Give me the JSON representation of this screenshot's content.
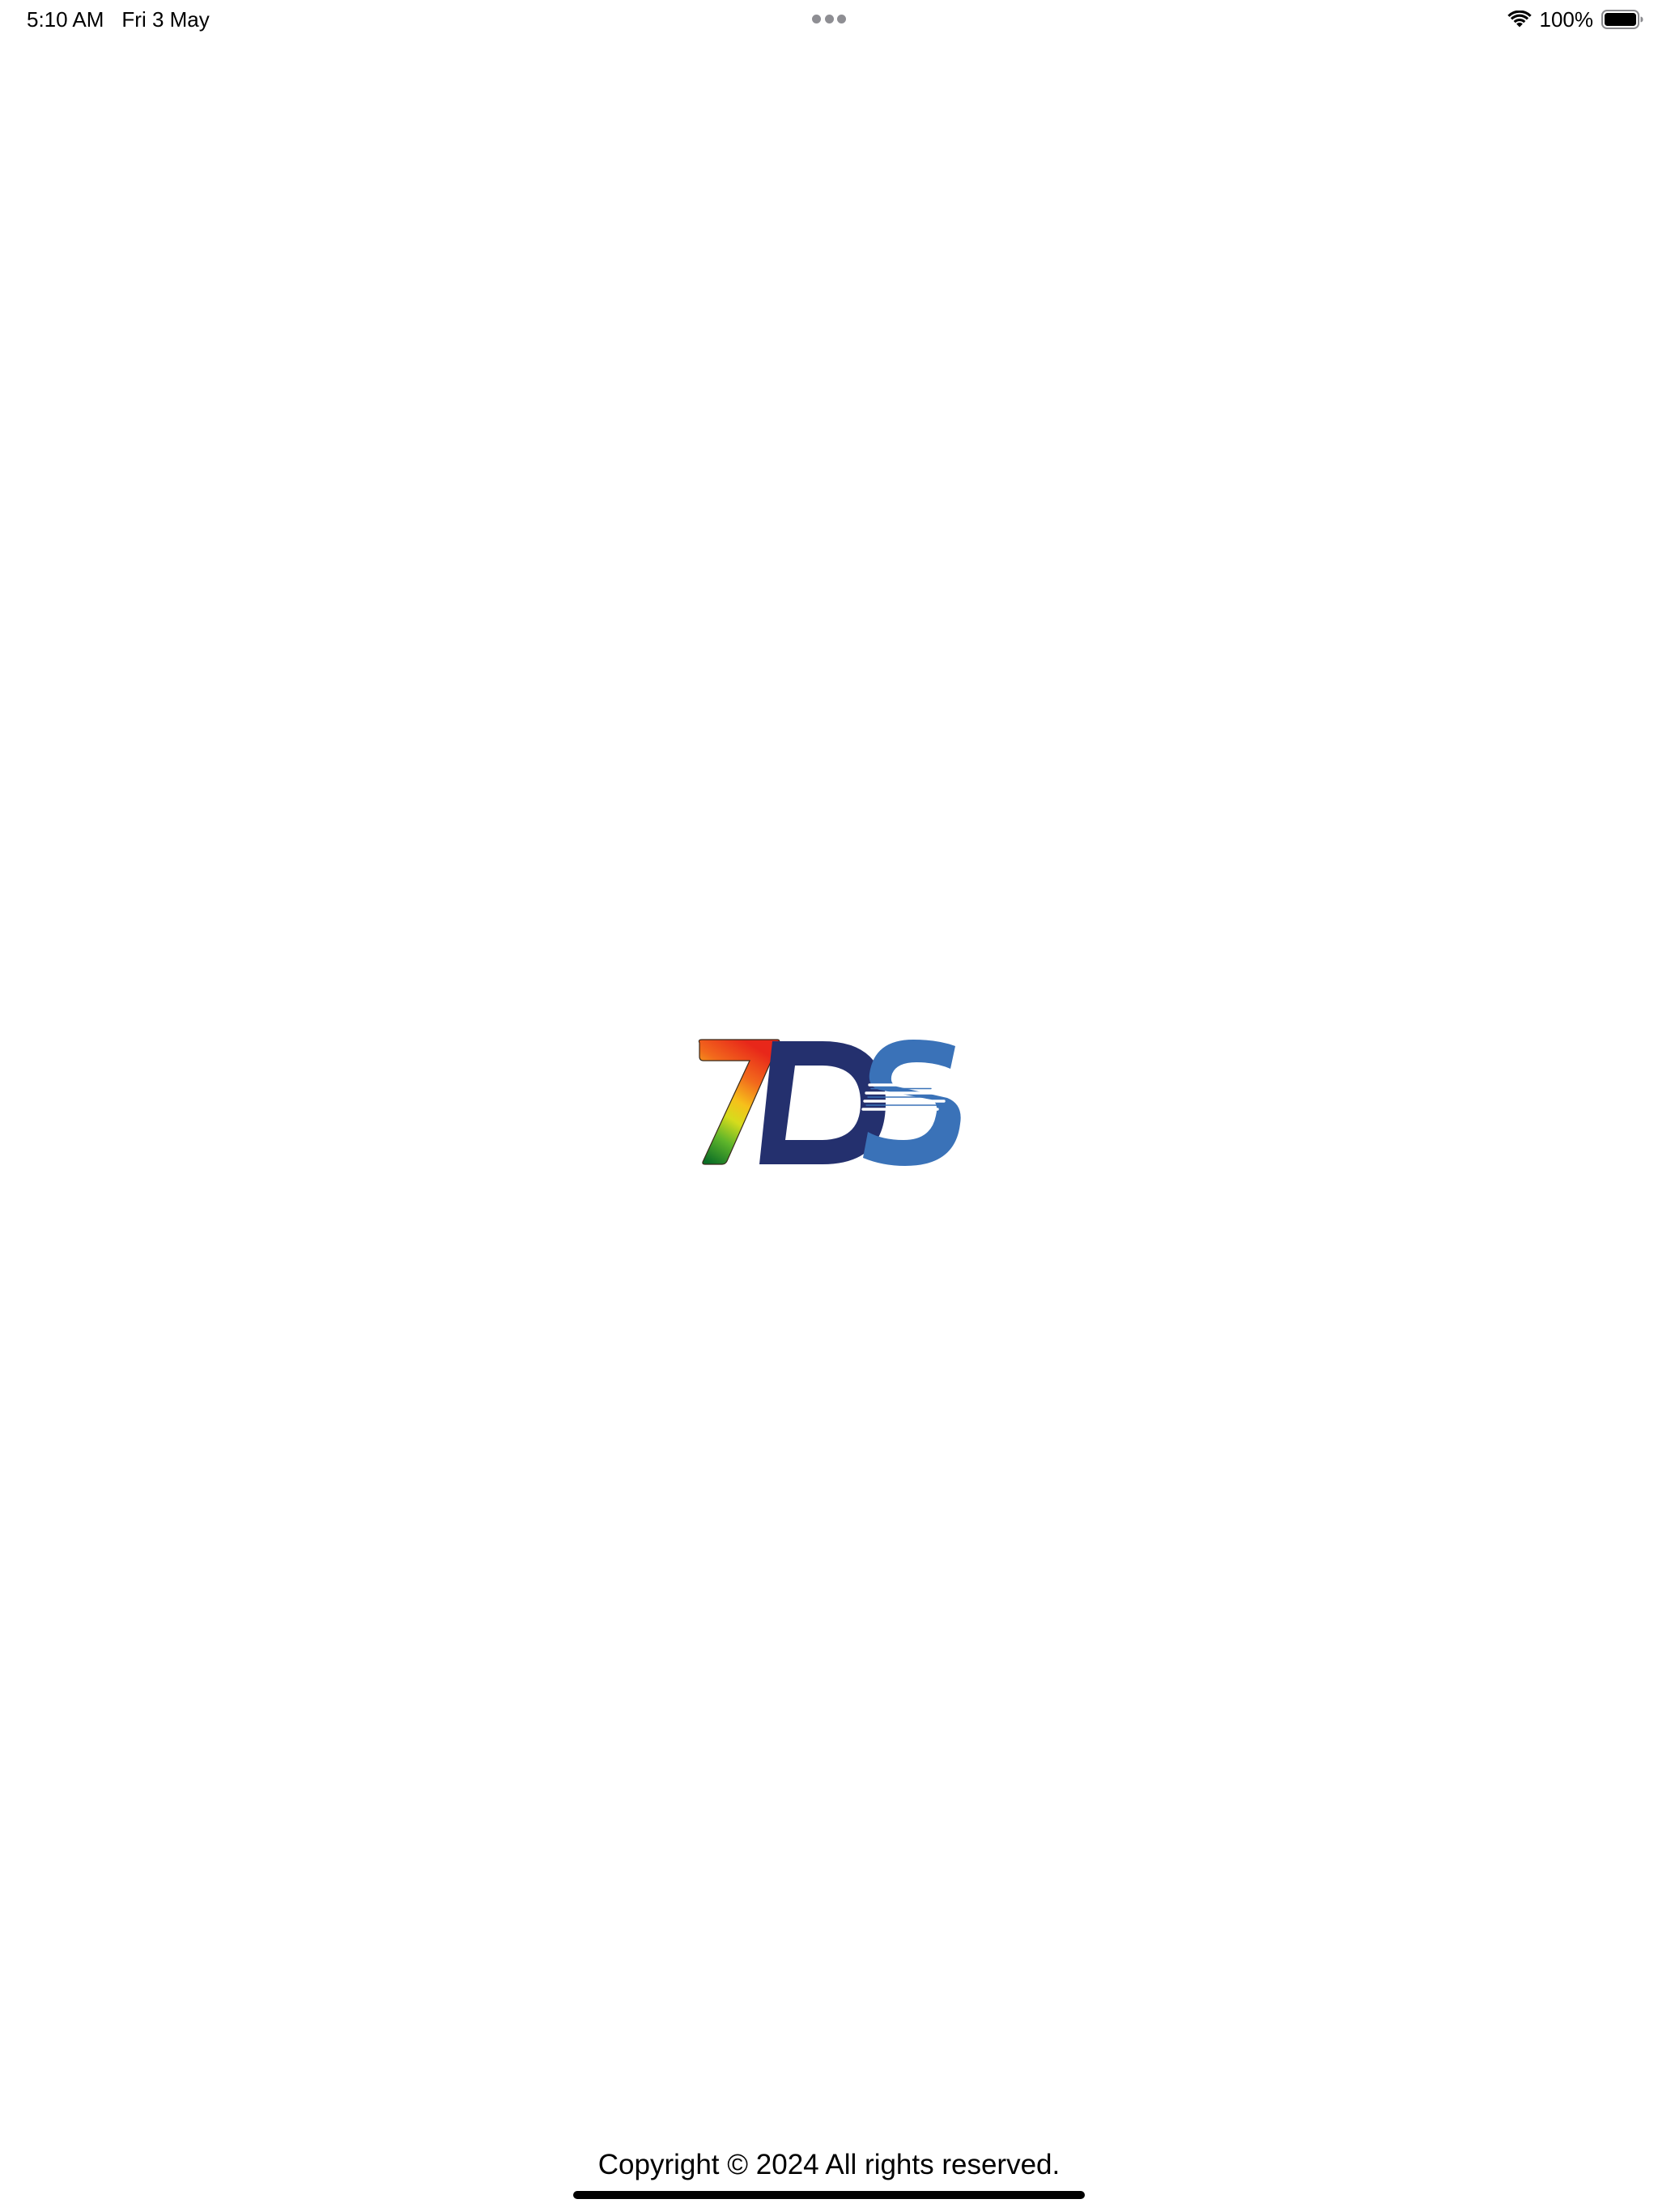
{
  "status_bar": {
    "time": "5:10 AM",
    "date": "Fri 3 May",
    "battery_percent": "100%",
    "battery_level": 1.0,
    "icons": [
      "wifi-icon",
      "battery-icon",
      "multitasking-dots-icon"
    ]
  },
  "splash": {
    "logo_text": "7DS",
    "logo_colors": {
      "seven_gradient": [
        "#e8271a",
        "#f6a21b",
        "#f3e31a",
        "#1f9a2f",
        "#0b6e26"
      ],
      "d_color": "#24306e",
      "s_color": "#3a72b8"
    }
  },
  "footer": {
    "copyright": "Copyright © 2024 All rights reserved."
  }
}
